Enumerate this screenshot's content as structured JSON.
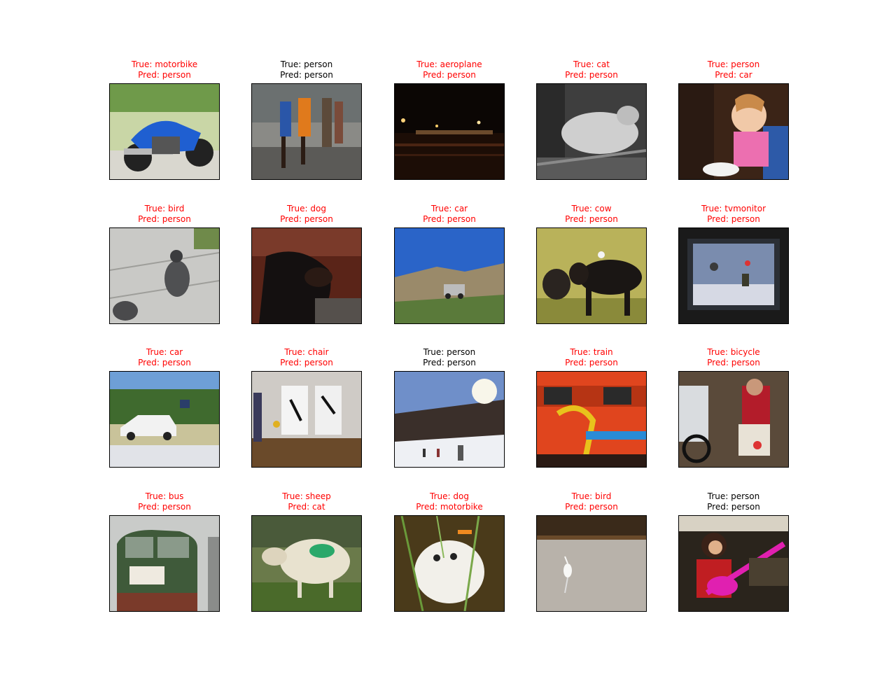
{
  "colors": {
    "correct": "#000000",
    "incorrect": "#ff0000"
  },
  "grid": [
    [
      {
        "true_label": "True: motorbike",
        "pred_label": "Pred: person",
        "correct": false,
        "scene": "motorbike"
      },
      {
        "true_label": "True: person",
        "pred_label": "Pred: person",
        "correct": true,
        "scene": "runners"
      },
      {
        "true_label": "True: aeroplane",
        "pred_label": "Pred: person",
        "correct": false,
        "scene": "night-airport"
      },
      {
        "true_label": "True: cat",
        "pred_label": "Pred: person",
        "correct": false,
        "scene": "cat"
      },
      {
        "true_label": "True: person",
        "pred_label": "Pred: car",
        "correct": false,
        "scene": "child-eating"
      }
    ],
    [
      {
        "true_label": "True: bird",
        "pred_label": "Pred: person",
        "correct": false,
        "scene": "pigeons"
      },
      {
        "true_label": "True: dog",
        "pred_label": "Pred: person",
        "correct": false,
        "scene": "dog"
      },
      {
        "true_label": "True: car",
        "pred_label": "Pred: person",
        "correct": false,
        "scene": "car-hill"
      },
      {
        "true_label": "True: cow",
        "pred_label": "Pred: person",
        "correct": false,
        "scene": "cows"
      },
      {
        "true_label": "True: tvmonitor",
        "pred_label": "Pred: person",
        "correct": false,
        "scene": "tv"
      }
    ],
    [
      {
        "true_label": "True: car",
        "pred_label": "Pred: person",
        "correct": false,
        "scene": "wrecked-car"
      },
      {
        "true_label": "True: chair",
        "pred_label": "Pred: person",
        "correct": false,
        "scene": "chairs"
      },
      {
        "true_label": "True: person",
        "pred_label": "Pred: person",
        "correct": true,
        "scene": "skiers"
      },
      {
        "true_label": "True: train",
        "pred_label": "Pred: person",
        "correct": false,
        "scene": "train"
      },
      {
        "true_label": "True: bicycle",
        "pred_label": "Pred: person",
        "correct": false,
        "scene": "cyclist"
      }
    ],
    [
      {
        "true_label": "True: bus",
        "pred_label": "Pred: person",
        "correct": false,
        "scene": "bus"
      },
      {
        "true_label": "True: sheep",
        "pred_label": "Pred: cat",
        "correct": false,
        "scene": "sheep"
      },
      {
        "true_label": "True: dog",
        "pred_label": "Pred: motorbike",
        "correct": false,
        "scene": "white-dog"
      },
      {
        "true_label": "True: bird",
        "pred_label": "Pred: person",
        "correct": false,
        "scene": "heron"
      },
      {
        "true_label": "True: person",
        "pred_label": "Pred: person",
        "correct": true,
        "scene": "guitarist"
      }
    ]
  ]
}
